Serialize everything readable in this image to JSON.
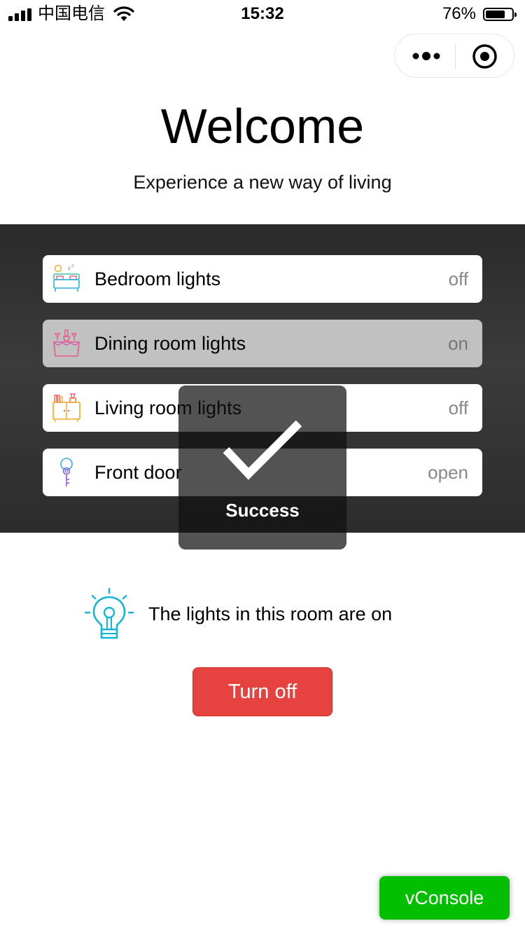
{
  "status_bar": {
    "carrier": "中国电信",
    "time": "15:32",
    "battery_percent": "76%",
    "battery_level": 0.76
  },
  "header": {
    "title": "Welcome",
    "subtitle": "Experience a new way of living"
  },
  "rooms": [
    {
      "label": "Bedroom lights",
      "state": "off",
      "icon": "bedroom-icon",
      "selected": false
    },
    {
      "label": "Dining room lights",
      "state": "on",
      "icon": "dining-icon",
      "selected": true
    },
    {
      "label": "Living room lights",
      "state": "off",
      "icon": "living-room-icon",
      "selected": false
    },
    {
      "label": "Front door",
      "state": "open",
      "icon": "key-icon",
      "selected": false
    }
  ],
  "toast": {
    "message": "Success",
    "icon": "checkmark-icon"
  },
  "room_status": {
    "text": "The lights in this room are on",
    "icon": "lightbulb-icon"
  },
  "action_button": {
    "label": "Turn off",
    "color": "#e64340"
  },
  "vconsole": {
    "label": "vConsole",
    "color": "#04be02"
  }
}
